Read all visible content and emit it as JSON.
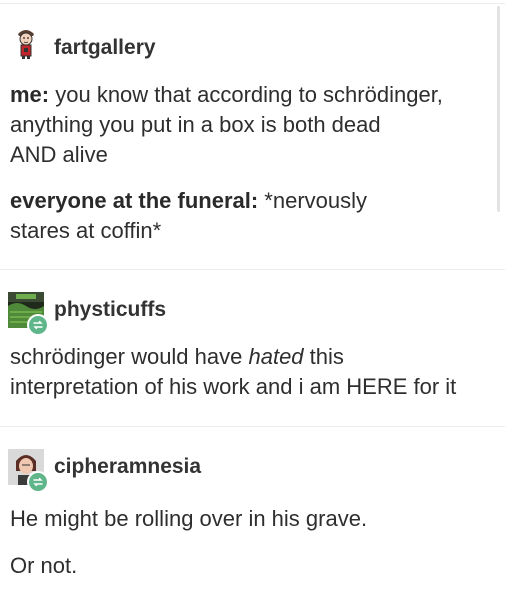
{
  "posts": [
    {
      "username": "fartgallery",
      "avatar_icon": "cartoon-character-avatar",
      "paragraphs": [
        {
          "lines": [
            {
              "bold": "me:",
              "text": " you know that according to schrödinger,"
            },
            {
              "text": "anything you put in a box is both dead"
            },
            {
              "text": "AND alive"
            }
          ]
        },
        {
          "lines": [
            {
              "bold": "everyone at the funeral:",
              "text": " *nervously"
            },
            {
              "text": "stares at coffin*"
            }
          ]
        }
      ]
    },
    {
      "username": "physticuffs",
      "avatar_icon": "green-landscape-avatar",
      "badge_icon": "reblog-icon",
      "paragraphs": [
        {
          "lines": [
            {
              "text": "schrödinger would have ",
              "italic": "hated",
              "text_after": " this"
            },
            {
              "text": "interpretation of his work and i am HERE for it"
            }
          ]
        }
      ]
    },
    {
      "username": "cipheramnesia",
      "avatar_icon": "person-portrait-avatar",
      "badge_icon": "reblog-icon",
      "paragraphs": [
        {
          "lines": [
            {
              "text": "He might be rolling over in his grave."
            }
          ]
        },
        {
          "lines": [
            {
              "text": "Or not."
            }
          ]
        }
      ]
    }
  ],
  "colors": {
    "reblog_badge": "#5fb68a",
    "divider": "#ececec",
    "text": "#2e2e2e"
  }
}
